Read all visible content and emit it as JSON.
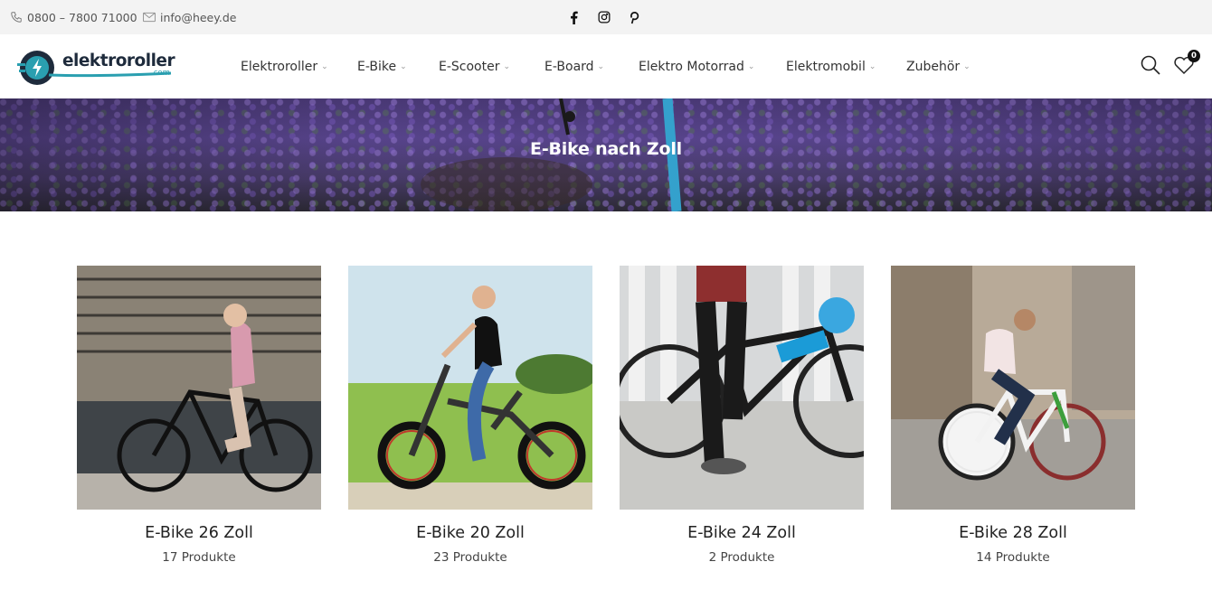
{
  "topbar": {
    "phone": "0800 – 7800 71000",
    "email": "info@heey.de",
    "social": [
      "facebook-icon",
      "instagram-icon",
      "pinterest-icon"
    ]
  },
  "header": {
    "logo_text": "elektroroller",
    "logo_suffix": ".com",
    "nav": [
      {
        "label": "Elektroroller"
      },
      {
        "label": "E-Bike"
      },
      {
        "label": "E-Scooter"
      },
      {
        "label": "E-Board"
      },
      {
        "label": "Elektro Motorrad"
      },
      {
        "label": "Elektromobil"
      },
      {
        "label": "Zubehör"
      }
    ],
    "wishlist_count": "0"
  },
  "banner": {
    "title": "E-Bike nach Zoll"
  },
  "categories": [
    {
      "name": "E-Bike 26 Zoll",
      "count": "17 Produkte"
    },
    {
      "name": "E-Bike 20 Zoll",
      "count": "23 Produkte"
    },
    {
      "name": "E-Bike 24 Zoll",
      "count": "2 Produkte"
    },
    {
      "name": "E-Bike 28 Zoll",
      "count": "14 Produkte"
    }
  ],
  "colors": {
    "topbar_bg": "#f3f3f3",
    "brand_teal": "#2a9fb0",
    "brand_dark": "#1e2b3c",
    "text": "#222222"
  }
}
